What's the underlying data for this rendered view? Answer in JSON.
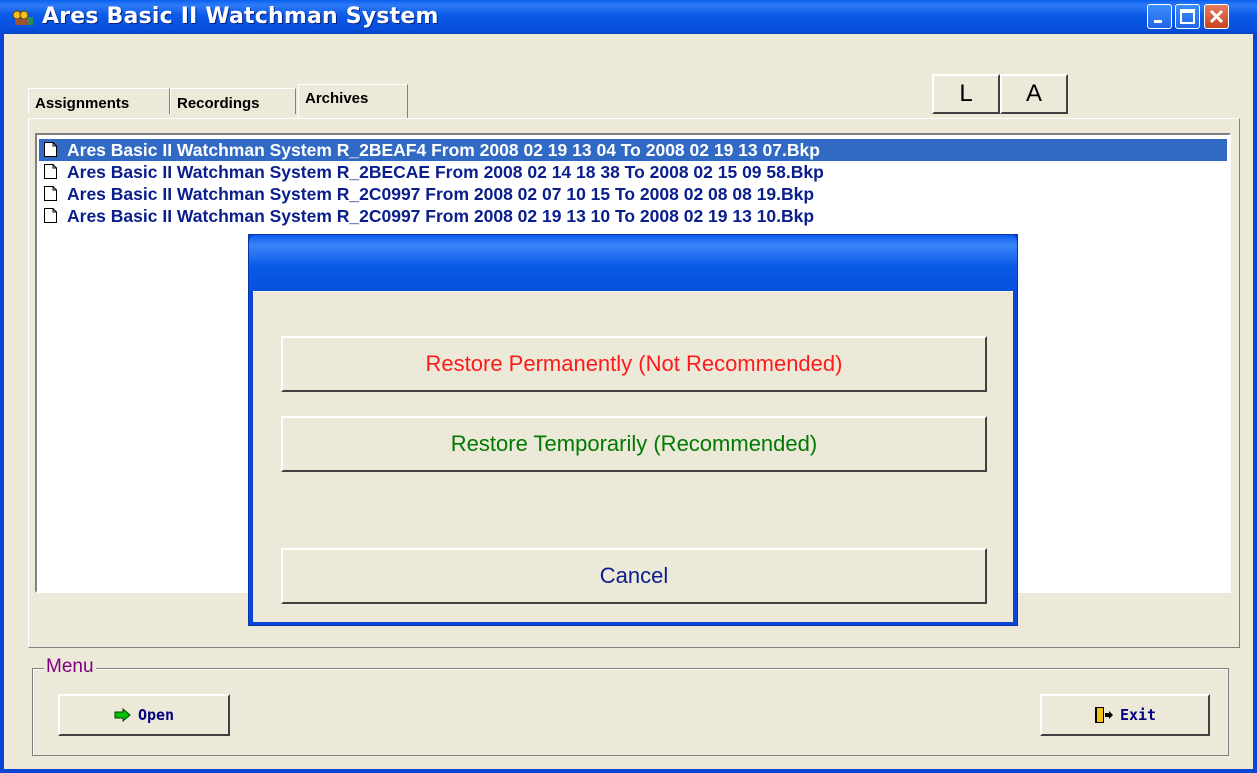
{
  "window": {
    "title": "Ares Basic II Watchman System",
    "controls": [
      "minimize-icon",
      "maximize-icon",
      "close-icon"
    ]
  },
  "tabs": [
    {
      "label": "Assignments",
      "active": false
    },
    {
      "label": "Recordings",
      "active": false
    },
    {
      "label": "Archives",
      "active": true
    }
  ],
  "toolbar": {
    "l_label": "L",
    "a_label": "A"
  },
  "archives": {
    "files": [
      {
        "name": "Ares Basic II Watchman System R_2BEAF4 From 2008 02 19 13 04 To 2008 02 19 13 07.Bkp",
        "selected": true
      },
      {
        "name": "Ares Basic II Watchman System R_2BECAE From 2008 02 14 18 38 To 2008 02 15 09 58.Bkp",
        "selected": false
      },
      {
        "name": "Ares Basic II Watchman System R_2C0997 From 2008 02 07 10 15 To 2008 02 08 08 19.Bkp",
        "selected": false
      },
      {
        "name": "Ares Basic II Watchman System R_2C0997 From 2008 02 19 13 10 To 2008 02 19 13 10.Bkp",
        "selected": false
      }
    ]
  },
  "menu": {
    "legend": "Menu",
    "open_label": "Open",
    "exit_label": "Exit"
  },
  "dialog": {
    "title": "",
    "restore_permanently": "Restore Permanently (Not Recommended)",
    "restore_temporarily": "Restore Temporarily (Recommended)",
    "cancel": "Cancel"
  },
  "colors": {
    "titlebar": "#0A5AE8",
    "selection": "#316AC5",
    "file_text": "#0A1E8C",
    "danger": "#FF1A1A",
    "recommended": "#007A00",
    "menu_legend": "#800080"
  }
}
